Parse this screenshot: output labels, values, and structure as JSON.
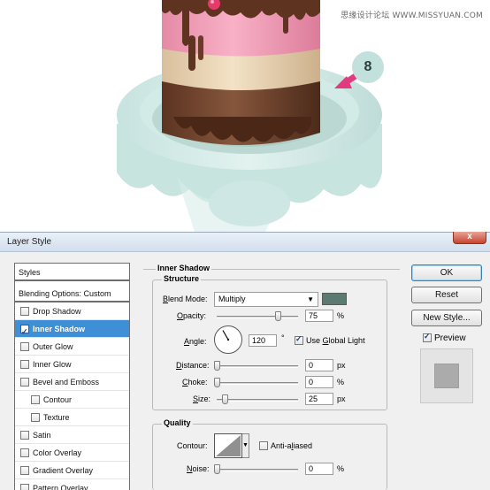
{
  "illustration": {
    "watermark": "思缘设计论坛 WWW.MISSYUAN.COM",
    "step_badge": "8"
  },
  "dialog": {
    "title": "Layer Style",
    "close_symbol": "x"
  },
  "styles_panel": {
    "header": "Styles",
    "blending_options": "Blending Options: Custom",
    "items": [
      {
        "label": "Drop Shadow",
        "checked": false,
        "selected": false,
        "indent": false
      },
      {
        "label": "Inner Shadow",
        "checked": true,
        "selected": true,
        "indent": false
      },
      {
        "label": "Outer Glow",
        "checked": false,
        "selected": false,
        "indent": false
      },
      {
        "label": "Inner Glow",
        "checked": false,
        "selected": false,
        "indent": false
      },
      {
        "label": "Bevel and Emboss",
        "checked": false,
        "selected": false,
        "indent": false
      },
      {
        "label": "Contour",
        "checked": false,
        "selected": false,
        "indent": true
      },
      {
        "label": "Texture",
        "checked": false,
        "selected": false,
        "indent": true
      },
      {
        "label": "Satin",
        "checked": false,
        "selected": false,
        "indent": false
      },
      {
        "label": "Color Overlay",
        "checked": false,
        "selected": false,
        "indent": false
      },
      {
        "label": "Gradient Overlay",
        "checked": false,
        "selected": false,
        "indent": false
      },
      {
        "label": "Pattern Overlay",
        "checked": false,
        "selected": false,
        "indent": false
      }
    ]
  },
  "inner_shadow": {
    "section_title": "Inner Shadow",
    "structure": {
      "group_title": "Structure",
      "blend_mode_label_u": "B",
      "blend_mode_label_rest": "lend Mode:",
      "blend_mode_value": "Multiply",
      "shadow_color": "#5b7a72",
      "opacity_label_u": "O",
      "opacity_label_rest": "pacity:",
      "opacity_value": "75",
      "opacity_unit": "%",
      "opacity_fraction": 0.75,
      "angle_label_u": "A",
      "angle_label_rest": "ngle:",
      "angle_value": "120",
      "angle_unit": "°",
      "use_global_light_label_u": "G",
      "use_global_light_label_pre": "Use ",
      "use_global_light_label_rest": "lobal Light",
      "use_global_light_checked": true,
      "distance_label_u": "D",
      "distance_label_rest": "istance:",
      "distance_value": "0",
      "distance_unit": "px",
      "distance_fraction": 0.0,
      "choke_label_u": "C",
      "choke_label_rest": "hoke:",
      "choke_value": "0",
      "choke_unit": "%",
      "choke_fraction": 0.0,
      "size_label_u": "S",
      "size_label_rest": "ize:",
      "size_value": "25",
      "size_unit": "px",
      "size_fraction": 0.1
    },
    "quality": {
      "group_title": "Quality",
      "contour_label": "Contour:",
      "anti_aliased_label_u": "l",
      "anti_aliased_label_pre": "Anti-a",
      "anti_aliased_label_rest": "iased",
      "anti_aliased_checked": false,
      "noise_label_u": "N",
      "noise_label_rest": "oise:",
      "noise_value": "0",
      "noise_unit": "%",
      "noise_fraction": 0.0
    }
  },
  "buttons": {
    "ok": "OK",
    "reset": "Reset",
    "new_style": "New Style...",
    "preview_label": "Preview",
    "preview_checked": true
  }
}
